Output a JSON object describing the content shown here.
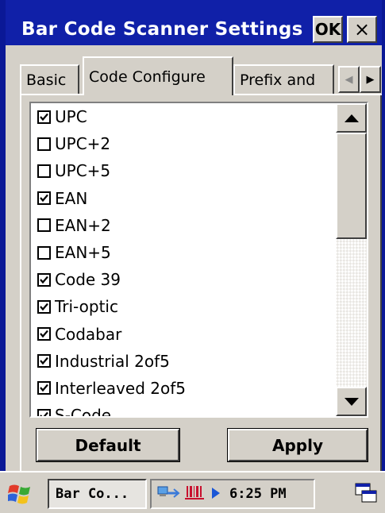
{
  "window": {
    "title": "Bar Code Scanner Settings",
    "ok_label": "OK",
    "close_glyph": "×"
  },
  "tabs": [
    {
      "label": "Basic",
      "selected": false
    },
    {
      "label": "Code Configure",
      "selected": true
    },
    {
      "label": "Prefix and",
      "selected": false
    }
  ],
  "tab_scroll": {
    "left_glyph": "◀",
    "right_glyph": "▶"
  },
  "codes": [
    {
      "label": "UPC",
      "checked": true
    },
    {
      "label": "UPC+2",
      "checked": false
    },
    {
      "label": "UPC+5",
      "checked": false
    },
    {
      "label": "EAN",
      "checked": true
    },
    {
      "label": "EAN+2",
      "checked": false
    },
    {
      "label": "EAN+5",
      "checked": false
    },
    {
      "label": "Code 39",
      "checked": true
    },
    {
      "label": "Tri-optic",
      "checked": true
    },
    {
      "label": "Codabar",
      "checked": true
    },
    {
      "label": "Industrial 2of5",
      "checked": true
    },
    {
      "label": "Interleaved 2of5",
      "checked": true
    },
    {
      "label": "S-Code",
      "checked": true
    }
  ],
  "buttons": {
    "default_label": "Default",
    "apply_label": "Apply"
  },
  "taskbar": {
    "task_label": "Bar Co...",
    "time": "6:25 PM"
  },
  "colors": {
    "title_bar": "#1020a8",
    "face": "#d4d0c8"
  }
}
